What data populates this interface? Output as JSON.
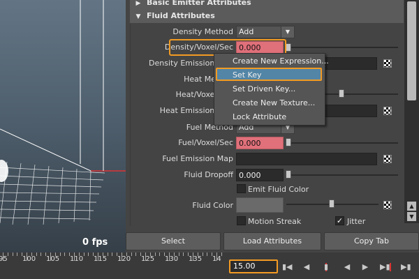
{
  "viewport": {
    "fps_label": "0 fps"
  },
  "sections": {
    "basic_emitter": "Basic Emitter Attributes",
    "fluid": "Fluid Attributes"
  },
  "attrs": {
    "density_method": {
      "label": "Density Method",
      "value": "Add"
    },
    "density_voxel": {
      "label": "Density/Voxel/Sec",
      "value": "0.000"
    },
    "density_emission": {
      "label": "Density Emission Map"
    },
    "heat_method": {
      "label": "Heat Method"
    },
    "heat_voxel": {
      "label": "Heat/Voxel/Sec"
    },
    "heat_emission": {
      "label": "Heat Emission Map"
    },
    "fuel_method": {
      "label": "Fuel Method",
      "value": "Add"
    },
    "fuel_voxel": {
      "label": "Fuel/Voxel/Sec",
      "value": "0.000"
    },
    "fuel_emission": {
      "label": "Fuel Emission Map"
    },
    "fluid_dropoff": {
      "label": "Fluid Dropoff",
      "value": "0.000"
    },
    "emit_fluid_color": {
      "label": "Emit Fluid Color"
    },
    "fluid_color": {
      "label": "Fluid Color"
    },
    "motion_streak": {
      "label": "Motion Streak"
    },
    "jitter": {
      "label": "Jitter"
    }
  },
  "context_menu": {
    "items": [
      "Create New Expression...",
      "Set Key",
      "Set Driven Key...",
      "Create New Texture...",
      "Lock Attribute"
    ]
  },
  "buttons": {
    "select": "Select",
    "load": "Load Attributes",
    "copy": "Copy Tab"
  },
  "timeline": {
    "ticks": [
      "95",
      "100",
      "105",
      "110",
      "115",
      "120",
      "125",
      "130",
      "135",
      "14"
    ],
    "current_time": "15.00"
  },
  "colors": {
    "highlight": "#f39b23",
    "menu_select": "#5285a6",
    "keyed_field": "#e0707a"
  }
}
